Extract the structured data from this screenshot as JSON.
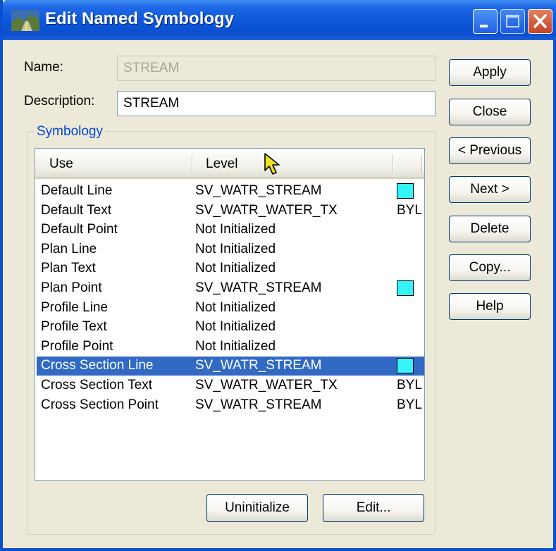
{
  "window": {
    "title": "Edit Named Symbology",
    "colors": {
      "titlebar": "#0a55d9",
      "selection": "#316ac5",
      "swatch": "#33f5f8",
      "group_title": "#0046d5"
    }
  },
  "form": {
    "name_label": "Name:",
    "name_value": "STREAM",
    "description_label": "Description:",
    "description_value": "STREAM"
  },
  "buttons": {
    "apply": "Apply",
    "close": "Close",
    "previous": "< Previous",
    "next": "Next >",
    "delete": "Delete",
    "copy": "Copy...",
    "help": "Help",
    "uninitialize": "Uninitialize",
    "edit": "Edit..."
  },
  "symbology": {
    "group_label": "Symbology",
    "columns": [
      "Use",
      "Level",
      ""
    ],
    "rows": [
      {
        "use": "Default Line",
        "level": "SV_WATR_STREAM",
        "symbol": "swatch"
      },
      {
        "use": "Default Text",
        "level": "SV_WATR_WATER_TX",
        "symbol": "BYL"
      },
      {
        "use": "Default Point",
        "level": "Not Initialized",
        "symbol": ""
      },
      {
        "use": "Plan Line",
        "level": "Not Initialized",
        "symbol": ""
      },
      {
        "use": "Plan Text",
        "level": "Not Initialized",
        "symbol": ""
      },
      {
        "use": "Plan Point",
        "level": "SV_WATR_STREAM",
        "symbol": "swatch"
      },
      {
        "use": "Profile Line",
        "level": "Not Initialized",
        "symbol": ""
      },
      {
        "use": "Profile Text",
        "level": "Not Initialized",
        "symbol": ""
      },
      {
        "use": "Profile Point",
        "level": "Not Initialized",
        "symbol": ""
      },
      {
        "use": "Cross Section Line",
        "level": "SV_WATR_STREAM",
        "symbol": "swatch",
        "selected": true
      },
      {
        "use": "Cross Section Text",
        "level": "SV_WATR_WATER_TX",
        "symbol": "BYL"
      },
      {
        "use": "Cross Section Point",
        "level": "SV_WATR_STREAM",
        "symbol": "BYL"
      }
    ]
  }
}
